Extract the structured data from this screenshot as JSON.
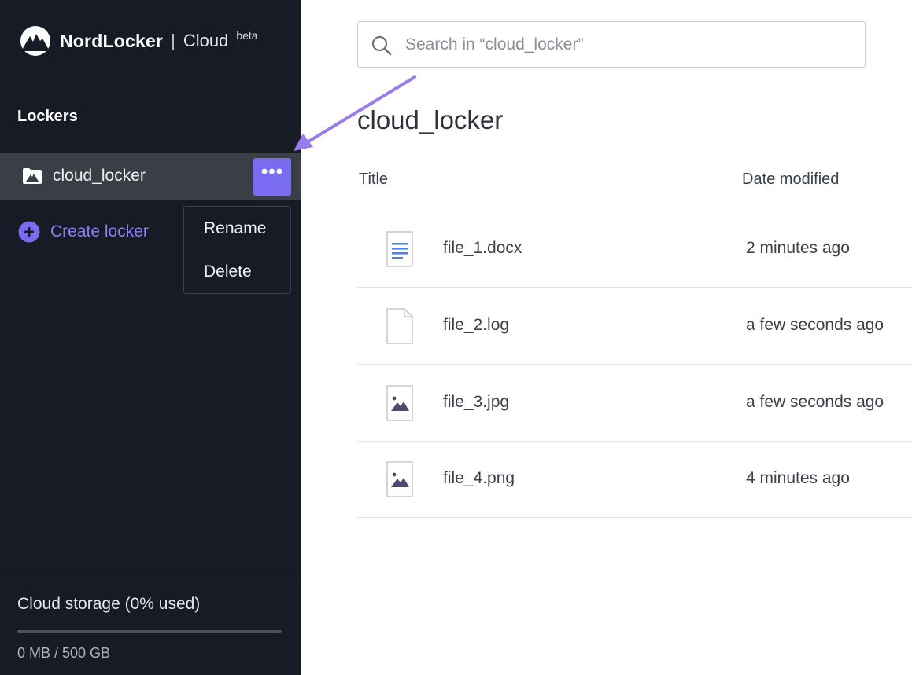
{
  "brand": {
    "name": "NordLocker",
    "separator": "|",
    "product": "Cloud",
    "badge": "beta"
  },
  "sidebar": {
    "section_title": "Lockers",
    "lockers": [
      {
        "label": "cloud_locker",
        "more_label": "•••"
      }
    ],
    "create_label": "Create locker",
    "context_menu": {
      "rename": "Rename",
      "delete": "Delete"
    },
    "storage": {
      "title": "Cloud storage (0% used)",
      "used_fraction": 0,
      "amount": "0 MB / 500 GB"
    }
  },
  "search": {
    "placeholder": "Search in “cloud_locker”",
    "value": ""
  },
  "main": {
    "title": "cloud_locker",
    "columns": {
      "title": "Title",
      "date": "Date modified"
    },
    "files": [
      {
        "name": "file_1.docx",
        "date": "2 minutes ago",
        "type": "document"
      },
      {
        "name": "file_2.log",
        "date": "a few seconds ago",
        "type": "generic"
      },
      {
        "name": "file_3.jpg",
        "date": "a few seconds ago",
        "type": "image"
      },
      {
        "name": "file_4.png",
        "date": "4 minutes ago",
        "type": "image"
      }
    ]
  },
  "colors": {
    "sidebar_bg": "#161b26",
    "accent": "#7a6cf0",
    "selected_bg": "#3a3e46",
    "arrow": "#9a7bea"
  }
}
